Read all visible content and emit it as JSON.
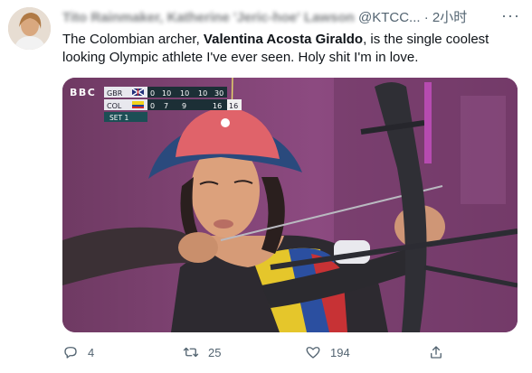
{
  "tweet": {
    "author_name": "Tito Rainmaker, Katherine 'Jeric-hoe' Lawson",
    "handle": "@KTCC...",
    "separator": "·",
    "time": "2小时",
    "text_before": "The Colombian archer, ",
    "text_bold": "Valentina Acosta Giraldo",
    "text_after": ", is the single coolest looking Olympic athlete I've ever seen. Holy shit I'm in love."
  },
  "scoreboard": {
    "network": "BBC",
    "set_label": "SET 1",
    "teams": [
      {
        "code": "GBR",
        "scores": [
          "0",
          "10",
          "10",
          "10",
          "30"
        ],
        "total": ""
      },
      {
        "code": "COL",
        "scores": [
          "0",
          "7",
          "9",
          "",
          "16"
        ],
        "total": "16"
      }
    ]
  },
  "actions": {
    "reply_count": "4",
    "retweet_count": "25",
    "like_count": "194"
  },
  "icons": {
    "reply": "reply-icon",
    "retweet": "retweet-icon",
    "like": "heart-icon",
    "share": "share-icon",
    "more": "more-icon"
  },
  "colors": {
    "text": "#0f1419",
    "secondary": "#536471",
    "hat": "#e0636a",
    "background": "#7a3f6d"
  }
}
